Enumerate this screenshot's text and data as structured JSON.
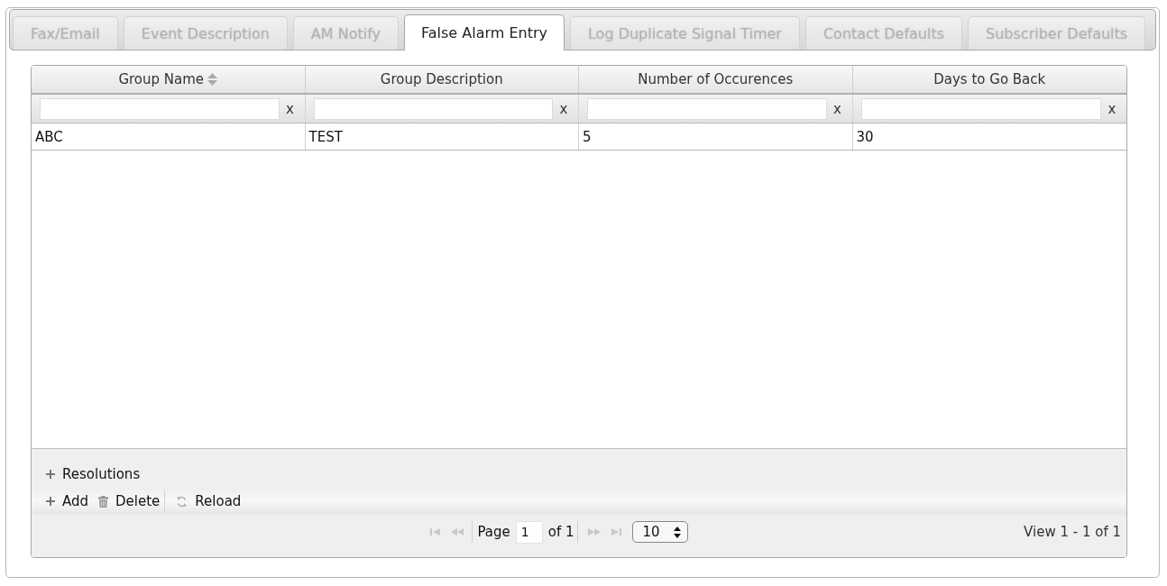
{
  "tabs": [
    {
      "label": "Fax/Email",
      "selected": false
    },
    {
      "label": "Event Description",
      "selected": false
    },
    {
      "label": "AM Notify",
      "selected": false
    },
    {
      "label": "False Alarm Entry",
      "selected": true
    },
    {
      "label": "Log Duplicate Signal Timer",
      "selected": false
    },
    {
      "label": "Contact Defaults",
      "selected": false
    },
    {
      "label": "Subscriber Defaults",
      "selected": false
    }
  ],
  "grid": {
    "columns": [
      {
        "label": "Group Name",
        "sorted": true
      },
      {
        "label": "Group Description",
        "sorted": false
      },
      {
        "label": "Number of Occurences",
        "sorted": false
      },
      {
        "label": "Days to Go Back",
        "sorted": false
      }
    ],
    "filters": [
      {
        "clear_label": "x"
      },
      {
        "clear_label": "x"
      },
      {
        "clear_label": "x"
      },
      {
        "clear_label": "x"
      }
    ],
    "rows": [
      {
        "cells": [
          "ABC",
          "TEST",
          "5",
          "30"
        ]
      }
    ],
    "subgrid": {
      "label": "Resolutions"
    },
    "toolbar": [
      {
        "kind": "add",
        "label": "Add"
      },
      {
        "kind": "delete",
        "label": "Delete"
      },
      {
        "kind": "separator"
      },
      {
        "kind": "reload",
        "label": "Reload"
      }
    ],
    "pager": {
      "nav_back": [
        {
          "kind": "first",
          "disabled": true
        },
        {
          "kind": "prev",
          "disabled": true
        }
      ],
      "page_label": "Page",
      "page": "1",
      "total": "of 1",
      "nav_forward": [
        {
          "kind": "next",
          "disabled": true
        },
        {
          "kind": "last",
          "disabled": true
        }
      ],
      "page_size": "10"
    },
    "record_info": "View 1 - 1 of 1"
  }
}
